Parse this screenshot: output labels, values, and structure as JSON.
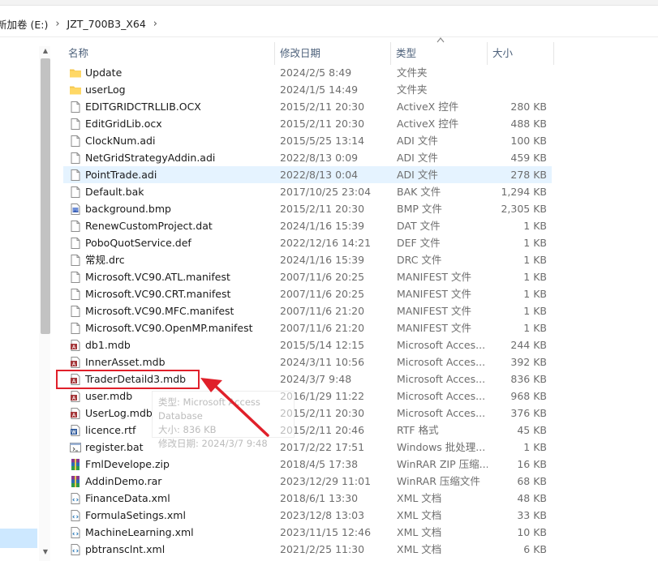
{
  "breadcrumb": {
    "drive": "新加卷 (E:)",
    "folder": "JZT_700B3_X64"
  },
  "columns": {
    "name": "名称",
    "date": "修改日期",
    "type": "类型",
    "size": "大小"
  },
  "tooltip": {
    "type_line": "类型: Microsoft Access Database",
    "size_line": "大小: 836 KB",
    "date_line": "修改日期: 2024/3/7 9:48"
  },
  "files": [
    {
      "name": "Update",
      "date": "2024/2/5 8:49",
      "type": "文件夹",
      "size": "",
      "icon": "folder-icon"
    },
    {
      "name": "userLog",
      "date": "2024/1/5 14:49",
      "type": "文件夹",
      "size": "",
      "icon": "folder-icon"
    },
    {
      "name": "EDITGRIDCTRLLIB.OCX",
      "date": "2015/2/11 20:30",
      "type": "ActiveX 控件",
      "size": "280 KB",
      "icon": "file-icon"
    },
    {
      "name": "EditGridLib.ocx",
      "date": "2015/2/11 20:30",
      "type": "ActiveX 控件",
      "size": "488 KB",
      "icon": "file-icon"
    },
    {
      "name": "ClockNum.adi",
      "date": "2015/5/25 13:14",
      "type": "ADI 文件",
      "size": "100 KB",
      "icon": "file-icon"
    },
    {
      "name": "NetGridStrategyAddin.adi",
      "date": "2022/8/13 0:09",
      "type": "ADI 文件",
      "size": "459 KB",
      "icon": "file-icon"
    },
    {
      "name": "PointTrade.adi",
      "date": "2022/8/13 0:04",
      "type": "ADI 文件",
      "size": "278 KB",
      "icon": "file-icon"
    },
    {
      "name": "Default.bak",
      "date": "2017/10/25 23:04",
      "type": "BAK 文件",
      "size": "1,294 KB",
      "icon": "file-icon"
    },
    {
      "name": "background.bmp",
      "date": "2015/2/11 20:30",
      "type": "BMP 文件",
      "size": "2,305 KB",
      "icon": "bmp-icon"
    },
    {
      "name": "RenewCustomProject.dat",
      "date": "2024/1/16 15:39",
      "type": "DAT 文件",
      "size": "1 KB",
      "icon": "file-icon"
    },
    {
      "name": "PoboQuotService.def",
      "date": "2022/12/16 14:21",
      "type": "DEF 文件",
      "size": "1 KB",
      "icon": "file-icon"
    },
    {
      "name": "常规.drc",
      "date": "2024/1/16 15:39",
      "type": "DRC 文件",
      "size": "1 KB",
      "icon": "file-icon"
    },
    {
      "name": "Microsoft.VC90.ATL.manifest",
      "date": "2007/11/6 20:25",
      "type": "MANIFEST 文件",
      "size": "1 KB",
      "icon": "file-icon"
    },
    {
      "name": "Microsoft.VC90.CRT.manifest",
      "date": "2007/11/6 20:25",
      "type": "MANIFEST 文件",
      "size": "1 KB",
      "icon": "file-icon"
    },
    {
      "name": "Microsoft.VC90.MFC.manifest",
      "date": "2007/11/6 21:20",
      "type": "MANIFEST 文件",
      "size": "1 KB",
      "icon": "file-icon"
    },
    {
      "name": "Microsoft.VC90.OpenMP.manifest",
      "date": "2007/11/6 21:20",
      "type": "MANIFEST 文件",
      "size": "1 KB",
      "icon": "file-icon"
    },
    {
      "name": "db1.mdb",
      "date": "2015/5/14 12:15",
      "type": "Microsoft Acces...",
      "size": "244 KB",
      "icon": "access-icon"
    },
    {
      "name": "InnerAsset.mdb",
      "date": "2024/3/11 10:56",
      "type": "Microsoft Acces...",
      "size": "392 KB",
      "icon": "access-icon"
    },
    {
      "name": "TraderDetaild3.mdb",
      "date": "2024/3/7 9:48",
      "type": "Microsoft Acces...",
      "size": "836 KB",
      "icon": "access-icon"
    },
    {
      "name": "user.mdb",
      "date": "2016/1/29 11:22",
      "type": "Microsoft Acces...",
      "size": "968 KB",
      "icon": "access-icon"
    },
    {
      "name": "UserLog.mdb",
      "date": "2015/2/11 20:30",
      "type": "Microsoft Acces...",
      "size": "376 KB",
      "icon": "access-icon"
    },
    {
      "name": "licence.rtf",
      "date": "2015/2/11 20:46",
      "type": "RTF 格式",
      "size": "45 KB",
      "icon": "rtf-icon"
    },
    {
      "name": "register.bat",
      "date": "2017/2/22 17:51",
      "type": "Windows 批处理...",
      "size": "1 KB",
      "icon": "bat-icon"
    },
    {
      "name": "FmlDevelope.zip",
      "date": "2018/4/5 17:38",
      "type": "WinRAR ZIP 压缩...",
      "size": "16 KB",
      "icon": "winrar-icon"
    },
    {
      "name": "AddinDemo.rar",
      "date": "2023/12/29 11:01",
      "type": "WinRAR 压缩文件",
      "size": "68 KB",
      "icon": "winrar-icon"
    },
    {
      "name": "FinanceData.xml",
      "date": "2018/6/1 13:30",
      "type": "XML 文档",
      "size": "48 KB",
      "icon": "xml-icon"
    },
    {
      "name": "FormulaSetings.xml",
      "date": "2023/12/8 13:03",
      "type": "XML 文档",
      "size": "33 KB",
      "icon": "xml-icon"
    },
    {
      "name": "MachineLearning.xml",
      "date": "2023/11/15 12:46",
      "type": "XML 文档",
      "size": "10 KB",
      "icon": "xml-icon"
    },
    {
      "name": "pbtransclnt.xml",
      "date": "2021/2/25 11:30",
      "type": "XML 文档",
      "size": "6 KB",
      "icon": "xml-icon"
    }
  ]
}
